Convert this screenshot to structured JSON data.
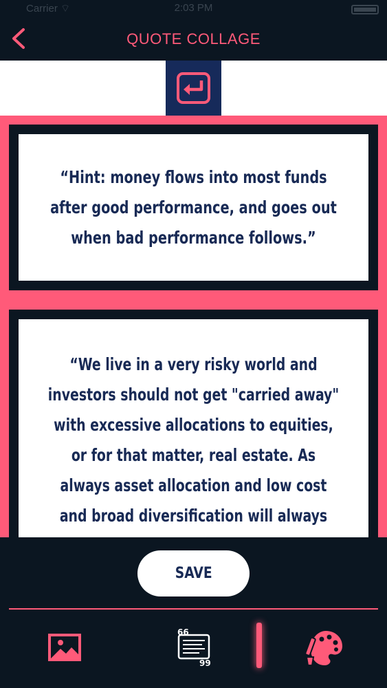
{
  "status_bar": {
    "carrier": "Carrier ⌔",
    "time": "2:03 PM"
  },
  "nav": {
    "back_icon": "chevron-left-icon",
    "title": "QUOTE COLLAGE"
  },
  "toolbar": {
    "swap_icon": "return-arrow-icon"
  },
  "collage": {
    "quotes": [
      "“Hint: money flows into most funds after good performance, and goes out when bad performance follows.”",
      "“We live in a very risky world and investors should not get \"carried away\" with excessive allocations to equities, or for that matter, real estate. As always asset allocation and low cost and broad diversification will always yield positive results at the end of the day.”"
    ]
  },
  "actions": {
    "save_label": "SAVE"
  },
  "tabs": [
    {
      "icon": "image-icon"
    },
    {
      "icon": "quote-text-icon"
    },
    {
      "icon": "palette-brush-icon"
    }
  ],
  "colors": {
    "accent": "#ff5a79",
    "navy": "#182a55",
    "background": "#0b1621"
  }
}
